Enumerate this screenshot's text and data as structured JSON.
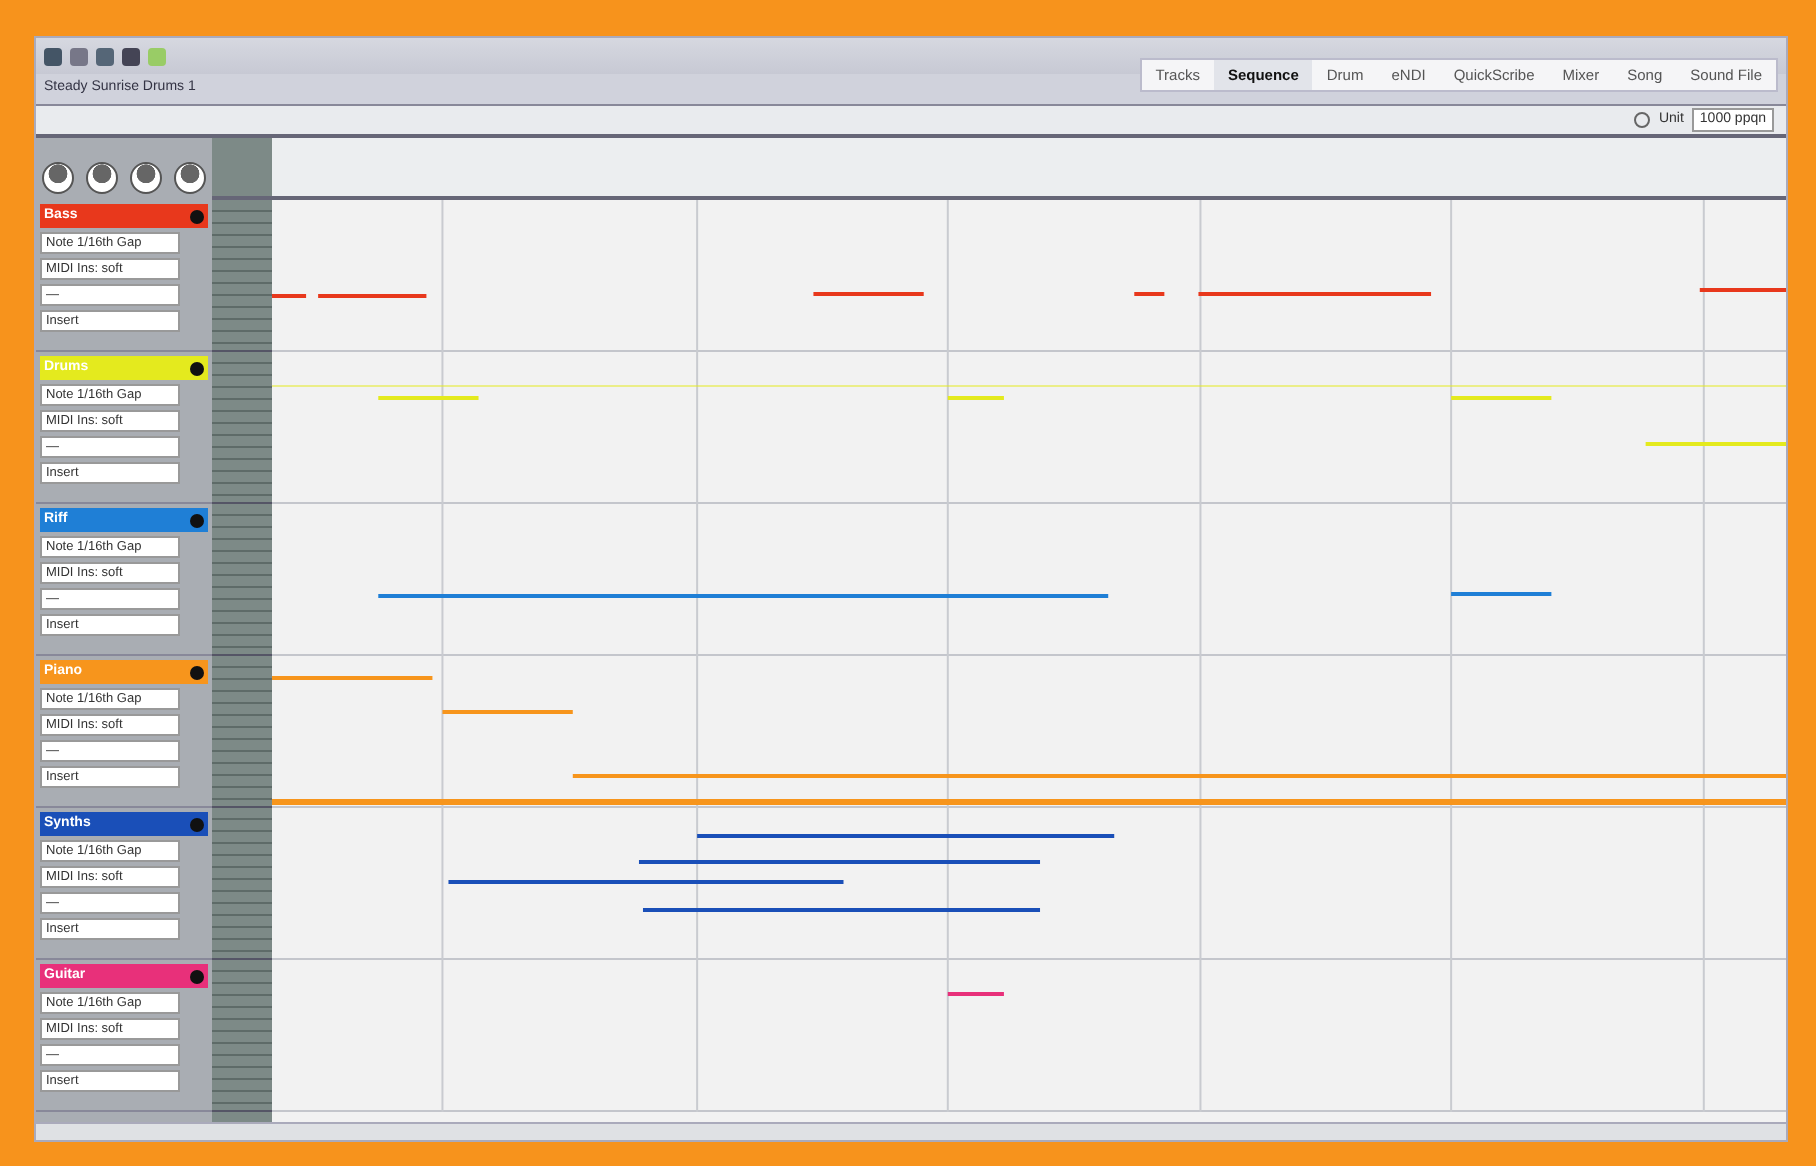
{
  "window": {
    "title": "Steady Sunrise Drums 1"
  },
  "tabs": [
    {
      "label": "Tracks",
      "selected": false
    },
    {
      "label": "Sequence",
      "selected": true
    },
    {
      "label": "Drum",
      "selected": false
    },
    {
      "label": "eNDI",
      "selected": false
    },
    {
      "label": "QuickScribe",
      "selected": false
    },
    {
      "label": "Mixer",
      "selected": false
    },
    {
      "label": "Song",
      "selected": false
    },
    {
      "label": "Sound File",
      "selected": false
    }
  ],
  "toolbar": {
    "unit": "Unit",
    "resolution": "1000 ppqn"
  },
  "tracks": [
    {
      "name": "Bass",
      "color": "#e8381c",
      "fields": [
        "Note 1/16th Gap",
        "MIDI Ins: soft",
        "—",
        "Insert"
      ]
    },
    {
      "name": "Drums",
      "color": "#e4ea1e",
      "fields": [
        "Note 1/16th Gap",
        "MIDI Ins: soft",
        "—",
        "Insert"
      ]
    },
    {
      "name": "Riff",
      "color": "#1f7fd6",
      "fields": [
        "Note 1/16th Gap",
        "MIDI Ins: soft",
        "—",
        "Insert"
      ]
    },
    {
      "name": "Piano",
      "color": "#f7951c",
      "fields": [
        "Note 1/16th Gap",
        "MIDI Ins: soft",
        "—",
        "Insert"
      ]
    },
    {
      "name": "Synths",
      "color": "#1a4fb8",
      "fields": [
        "Note 1/16th Gap",
        "MIDI Ins: soft",
        "—",
        "Insert"
      ]
    },
    {
      "name": "Guitar",
      "color": "#e8307a",
      "fields": [
        "Note 1/16th Gap",
        "MIDI Ins: soft",
        "—",
        "Insert"
      ]
    }
  ]
}
